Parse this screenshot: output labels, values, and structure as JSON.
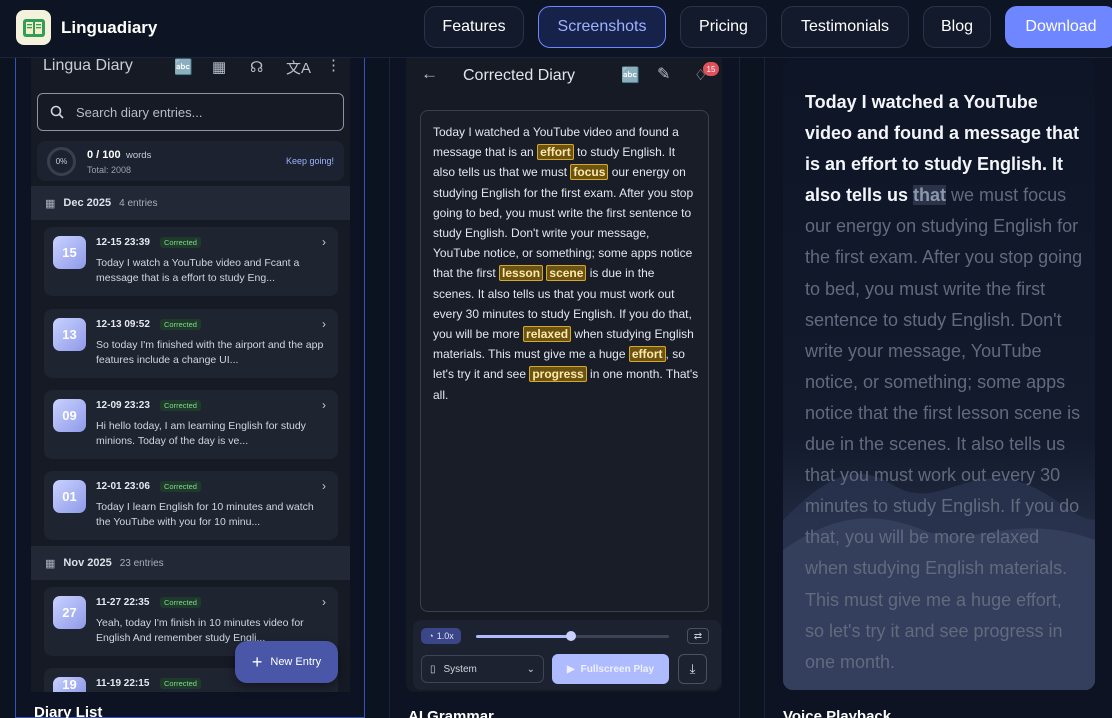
{
  "nav": {
    "brand": "Linguadiary",
    "links": [
      "Features",
      "Screenshots",
      "Pricing",
      "Testimonials",
      "Blog"
    ],
    "download": "Download"
  },
  "colors": {
    "accent": "#6e86ff",
    "highlight": "#d8a72a",
    "tag_green": "#7fd98f"
  },
  "diary_list": {
    "app_title": "Lingua Diary",
    "search_placeholder": "Search diary entries...",
    "progress": {
      "pct": "0%",
      "count": "0 / 100",
      "unit": "words",
      "total": "Total: 2008",
      "cta": "Keep going!",
      "fraction": 0
    },
    "months": [
      {
        "name": "Dec 2025",
        "count": "4 entries"
      },
      {
        "name": "Nov 2025",
        "count": "23 entries"
      }
    ],
    "entries": [
      {
        "day": "15",
        "datetime": "12-15 23:39",
        "tag": "Corrected",
        "preview": "Today I watch a YouTube video and Fcant a message that is a effort to study Eng..."
      },
      {
        "day": "13",
        "datetime": "12-13 09:52",
        "tag": "Corrected",
        "preview": "So today I'm finished with the airport and the app features include a change UI..."
      },
      {
        "day": "09",
        "datetime": "12-09 23:23",
        "tag": "Corrected",
        "preview": "Hi hello today, I am learning English for study minions. Today of the day is ve..."
      },
      {
        "day": "01",
        "datetime": "12-01 23:06",
        "tag": "Corrected",
        "preview": "Today I learn English for 10 minutes and watch the YouTube with you for 10 minu..."
      },
      {
        "day": "27",
        "datetime": "11-27 22:35",
        "tag": "Corrected",
        "preview": "Yeah, today I'm finish in 10 minutes video for English And remember study Engli..."
      },
      {
        "day": "19",
        "datetime": "11-19 22:15",
        "tag": "Corrected",
        "preview": ""
      }
    ],
    "fab": "New Entry",
    "caption": "Diary List"
  },
  "corrected": {
    "title": "Corrected Diary",
    "badge": "15",
    "segments": [
      {
        "t": "Today I watched a YouTube video and found a message that is an "
      },
      {
        "t": "effort",
        "hl": true
      },
      {
        "t": " to study English. It also tells us that we must "
      },
      {
        "t": "focus",
        "hl": true
      },
      {
        "t": " our energy on studying English for the first exam. After you stop going to bed, you must write the first sentence to study English. Don't write your message, YouTube notice, or something; some apps notice that the first "
      },
      {
        "t": "lesson",
        "hl": true
      },
      {
        "t": " "
      },
      {
        "t": "scene",
        "hl": true
      },
      {
        "t": " is due in the scenes. It also tells us that you must work out every 30 minutes to study English. If you do that, you will be more "
      },
      {
        "t": "relaxed",
        "hl": true
      },
      {
        "t": " when studying English materials. This must give me a huge "
      },
      {
        "t": "effort",
        "hl": true
      },
      {
        "t": ", so let's try it and see "
      },
      {
        "t": "progress",
        "hl": true
      },
      {
        "t": " in one month. That's all."
      }
    ],
    "speed": "1.0x",
    "playback_fraction": 0.49,
    "voice": "System",
    "play": "Fullscreen Play",
    "caption": "AI Grammar"
  },
  "voice": {
    "read": "Today I watched a YouTube video and found a message that is an effort to study English. It also tells us ",
    "current": "that",
    "rest": " we must focus our energy on studying English for the first exam. After you stop going to bed, you must write the first sentence to study English. Don't write your message, YouTube notice, or something; some apps notice that the first lesson scene is due in the scenes. It also tells us that you must work out every 30 minutes to study English. If you do that, you will be more relaxed when studying English materials. This must give me a huge effort, so let's try it and see progress in one month.",
    "caption": "Voice Playback"
  }
}
